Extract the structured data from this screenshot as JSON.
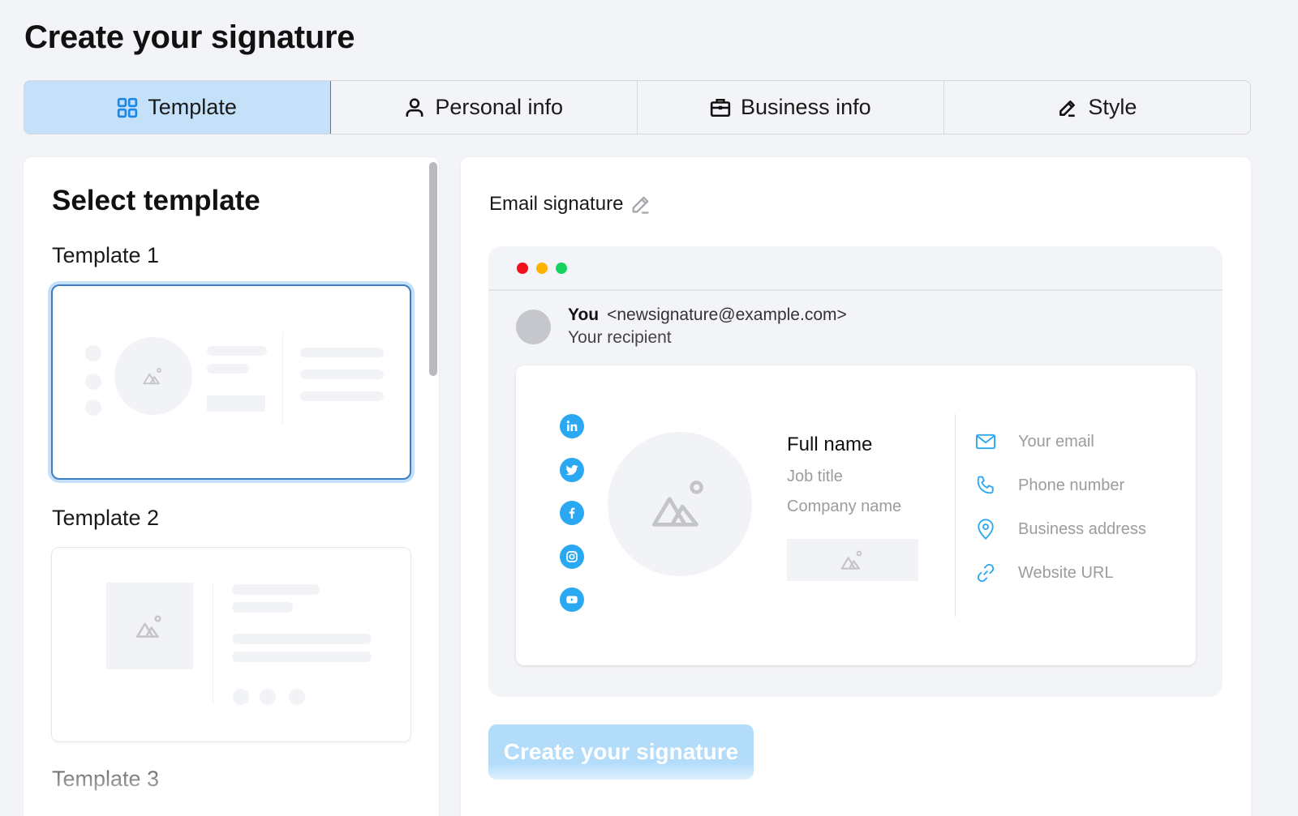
{
  "page": {
    "title": "Create your signature"
  },
  "tabs": [
    {
      "label": "Template",
      "icon": "grid-icon",
      "active": true
    },
    {
      "label": "Personal info",
      "icon": "user-icon",
      "active": false
    },
    {
      "label": "Business info",
      "icon": "briefcase-icon",
      "active": false
    },
    {
      "label": "Style",
      "icon": "pencil-icon",
      "active": false
    }
  ],
  "left_panel": {
    "title": "Select template",
    "templates": [
      {
        "label": "Template 1",
        "selected": true
      },
      {
        "label": "Template 2",
        "selected": false
      },
      {
        "label": "Template 3",
        "selected": false
      }
    ]
  },
  "preview": {
    "title": "Email signature",
    "window_dots": {
      "red": "#f20f1a",
      "yellow": "#ffb200",
      "green": "#17d25f"
    },
    "sender_name": "You",
    "sender_email": "<newsignature@example.com>",
    "recipient": "Your recipient",
    "signature": {
      "full_name": "Full name",
      "job_title": "Job title",
      "company_name": "Company name",
      "social_icons": [
        "linkedin-icon",
        "twitter-icon",
        "facebook-icon",
        "instagram-icon",
        "youtube-icon"
      ],
      "contacts": [
        {
          "icon": "mail-icon",
          "label": "Your email"
        },
        {
          "icon": "phone-icon",
          "label": "Phone number"
        },
        {
          "icon": "location-pin-icon",
          "label": "Business address"
        },
        {
          "icon": "link-icon",
          "label": "Website URL"
        }
      ],
      "accent_color": "#2aa8f2"
    },
    "cta_label": "Create your signature"
  }
}
